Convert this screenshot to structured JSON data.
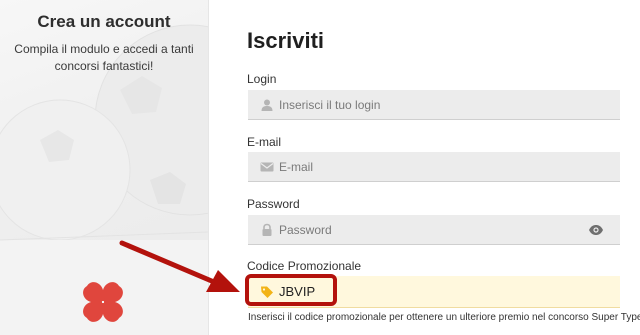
{
  "promo_panel": {
    "title": "Crea un account",
    "subtitle": "Compila il modulo e accedi a tanti concorsi fantastici!",
    "logo_icon": "clover-icon"
  },
  "form": {
    "title": "Iscriviti",
    "login": {
      "label": "Login",
      "placeholder": "Inserisci il tuo login",
      "icon": "user-icon"
    },
    "email": {
      "label": "E-mail",
      "placeholder": "E-mail",
      "icon": "envelope-icon"
    },
    "password": {
      "label": "Password",
      "placeholder": "Password",
      "icon": "lock-icon",
      "toggle_icon": "eye-icon"
    },
    "promo": {
      "label": "Codice Promozionale",
      "value": "JBVIP",
      "icon": "tag-icon",
      "hint": "Inserisci il codice promozionale per ottenere un ulteriore premio nel concorso Super Typer"
    }
  },
  "colors": {
    "highlight": "#b3120c",
    "promo_bg": "#fff8dd",
    "clover": "#e0463d",
    "tag": "#f2b316"
  }
}
